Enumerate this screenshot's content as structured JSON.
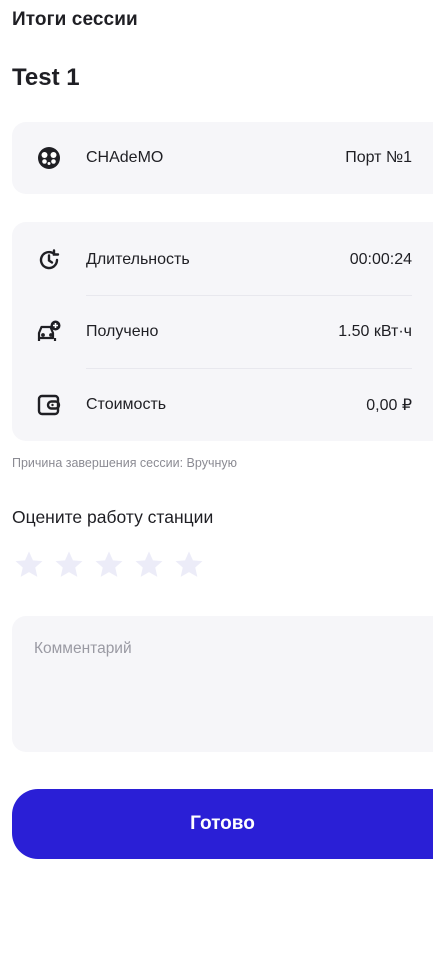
{
  "header": {
    "title": "Итоги сессии"
  },
  "session": {
    "name": "Test 1"
  },
  "connector": {
    "icon": "chademo-connector-icon",
    "name": "CHAdeMO",
    "port": "Порт №1"
  },
  "stats": [
    {
      "icon": "clock-refresh-icon",
      "label": "Длительность",
      "value": "00:00:24"
    },
    {
      "icon": "car-charge-icon",
      "label": "Получено",
      "value": "1.50 кВт·ч"
    },
    {
      "icon": "wallet-icon",
      "label": "Стоимость",
      "value": "0,00 ₽"
    }
  ],
  "reason": "Причина завершения сессии: Вручную",
  "rating": {
    "title": "Оцените работу станции",
    "max_stars": 5,
    "selected": 0,
    "star_color": "#ececf8"
  },
  "comment": {
    "placeholder": "Комментарий",
    "value": ""
  },
  "actions": {
    "done_label": "Готово"
  },
  "colors": {
    "accent": "#2a1fd6",
    "card_bg": "#f6f6f9"
  }
}
